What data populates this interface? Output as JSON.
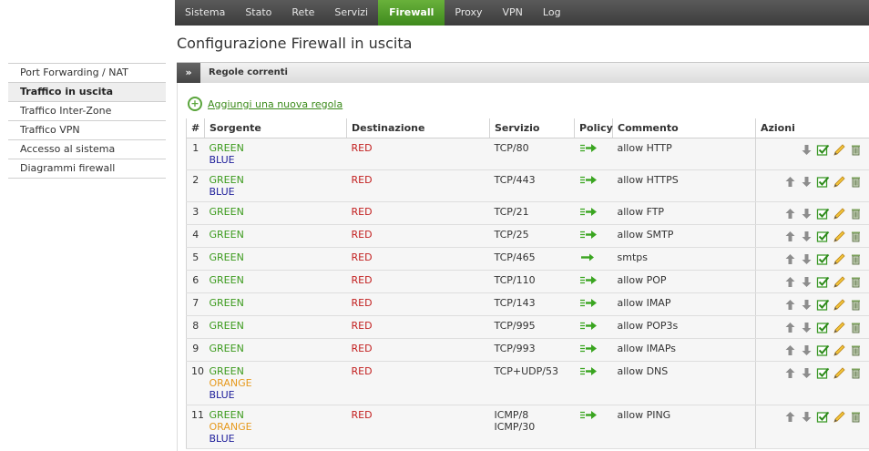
{
  "topnav": {
    "items": [
      "Sistema",
      "Stato",
      "Rete",
      "Servizi",
      "Firewall",
      "Proxy",
      "VPN",
      "Log"
    ],
    "active": "Firewall",
    "active_color": "#4f9d27"
  },
  "page_title": "Configurazione Firewall in uscita",
  "sidebar": {
    "items": [
      "Port Forwarding / NAT",
      "Traffico in uscita",
      "Traffico Inter-Zone",
      "Traffico VPN",
      "Accesso al sistema",
      "Diagrammi firewall"
    ],
    "active": "Traffico in uscita"
  },
  "panel": {
    "chevron": "»",
    "title": "Regole correnti"
  },
  "add_rule_label": "Aggiungi una nuova regola",
  "table": {
    "headers": [
      "#",
      "Sorgente",
      "Destinazione",
      "Servizio",
      "Policy",
      "Commento",
      "Azioni"
    ],
    "rows": [
      {
        "num": "1",
        "src": [
          "GREEN",
          "BLUE"
        ],
        "dst": [
          "RED"
        ],
        "svc": [
          "TCP/80"
        ],
        "policy": "allow",
        "comment": "allow HTTP",
        "first": true
      },
      {
        "num": "2",
        "src": [
          "GREEN",
          "BLUE"
        ],
        "dst": [
          "RED"
        ],
        "svc": [
          "TCP/443"
        ],
        "policy": "allow",
        "comment": "allow HTTPS"
      },
      {
        "num": "3",
        "src": [
          "GREEN"
        ],
        "dst": [
          "RED"
        ],
        "svc": [
          "TCP/21"
        ],
        "policy": "allow",
        "comment": "allow FTP"
      },
      {
        "num": "4",
        "src": [
          "GREEN"
        ],
        "dst": [
          "RED"
        ],
        "svc": [
          "TCP/25"
        ],
        "policy": "allow",
        "comment": "allow SMTP"
      },
      {
        "num": "5",
        "src": [
          "GREEN"
        ],
        "dst": [
          "RED"
        ],
        "svc": [
          "TCP/465"
        ],
        "policy": "accept",
        "comment": "smtps"
      },
      {
        "num": "6",
        "src": [
          "GREEN"
        ],
        "dst": [
          "RED"
        ],
        "svc": [
          "TCP/110"
        ],
        "policy": "allow",
        "comment": "allow POP"
      },
      {
        "num": "7",
        "src": [
          "GREEN"
        ],
        "dst": [
          "RED"
        ],
        "svc": [
          "TCP/143"
        ],
        "policy": "allow",
        "comment": "allow IMAP"
      },
      {
        "num": "8",
        "src": [
          "GREEN"
        ],
        "dst": [
          "RED"
        ],
        "svc": [
          "TCP/995"
        ],
        "policy": "allow",
        "comment": "allow POP3s"
      },
      {
        "num": "9",
        "src": [
          "GREEN"
        ],
        "dst": [
          "RED"
        ],
        "svc": [
          "TCP/993"
        ],
        "policy": "allow",
        "comment": "allow IMAPs"
      },
      {
        "num": "10",
        "src": [
          "GREEN",
          "ORANGE",
          "BLUE"
        ],
        "dst": [
          "RED"
        ],
        "svc": [
          "TCP+UDP/53"
        ],
        "policy": "allow",
        "comment": "allow DNS"
      },
      {
        "num": "11",
        "src": [
          "GREEN",
          "ORANGE",
          "BLUE"
        ],
        "dst": [
          "RED"
        ],
        "svc": [
          "ICMP/8",
          "ICMP/30"
        ],
        "policy": "allow",
        "comment": "allow PING"
      }
    ]
  },
  "colors": {
    "GREEN": "#3b9a1c",
    "BLUE": "#1d1d9a",
    "RED": "#c21d1d",
    "ORANGE": "#e69a1e"
  },
  "action_icons": [
    "up-arrow-icon",
    "down-arrow-icon",
    "checkbox-enabled-icon",
    "pencil-edit-icon",
    "trash-icon"
  ]
}
